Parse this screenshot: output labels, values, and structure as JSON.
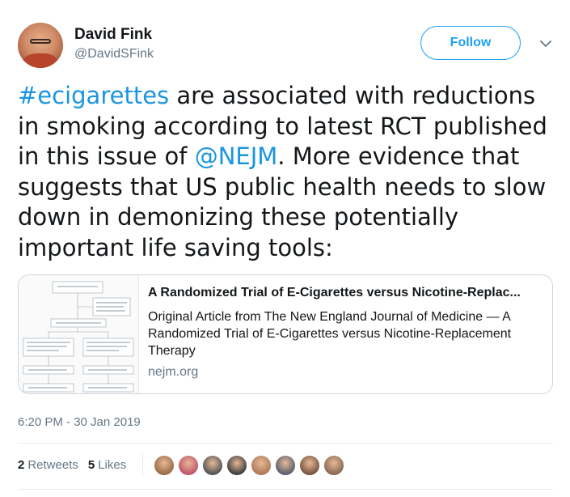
{
  "author": {
    "name": "David Fink",
    "handle": "@DavidSFink"
  },
  "follow_label": "Follow",
  "tweet": {
    "hashtag": "#ecigarettes",
    "text_1": " are associated with reductions in smoking according to latest RCT published in this issue of ",
    "mention": "@NEJM",
    "text_2": ". More evidence that suggests that US public health needs to slow down in demonizing these potentially important life saving tools:"
  },
  "card": {
    "title": "A Randomized Trial of E-Cigarettes versus Nicotine-Replac...",
    "description": "Original Article from The New England Journal of Medicine — A Randomized Trial of E-Cigarettes versus Nicotine-Replacement Therapy",
    "domain": "nejm.org"
  },
  "timestamp": "6:20 PM - 30 Jan 2019",
  "stats": {
    "retweets_count": "2",
    "retweets_label": "Retweets",
    "likes_count": "5",
    "likes_label": "Likes"
  },
  "likers": [
    {
      "color": "#9b6b4a"
    },
    {
      "color": "#c2566b"
    },
    {
      "color": "#555555"
    },
    {
      "color": "#3f3f3f"
    },
    {
      "color": "#b07a5a"
    },
    {
      "color": "#5a6170"
    },
    {
      "color": "#7a5540"
    },
    {
      "color": "#8a6a55"
    }
  ]
}
